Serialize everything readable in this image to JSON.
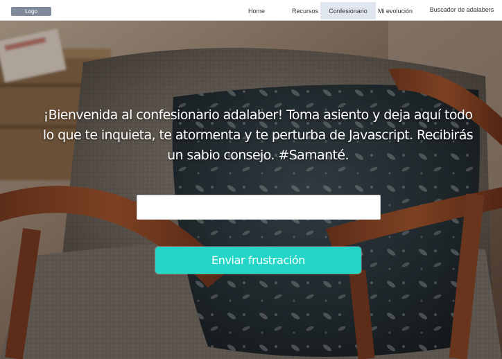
{
  "navbar": {
    "logo": "Logo",
    "links": [
      {
        "label": "Home",
        "active": false
      },
      {
        "label": "Recursos",
        "active": false
      },
      {
        "label": "Confesionario",
        "active": true
      },
      {
        "label": "Mi evolución",
        "active": false
      },
      {
        "label": "Buscador de adalabers",
        "active": false
      }
    ]
  },
  "hero": {
    "welcome_text": "¡Bienvenida al confesionario adalaber! Toma asiento y deja aquí todo lo que te inquieta, te atormenta y te perturba de Javascript. Recibirás un sabio consejo. #Samanté.",
    "input_value": "",
    "input_placeholder": "",
    "button_label": "Enviar frustración"
  },
  "colors": {
    "accent_button": "#25d6c8",
    "nav_active_bg": "#dfe6f0",
    "logo_bg": "#7f8a9a"
  }
}
